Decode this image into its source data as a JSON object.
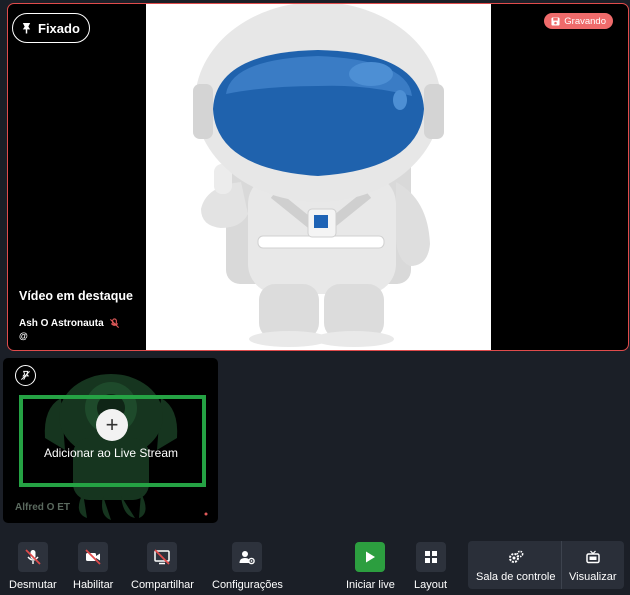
{
  "stage": {
    "pin_label": "Fixado",
    "recording_label": "Gravando",
    "featured_label": "Vídeo em destaque",
    "participant_name": "Ash O Astronauta",
    "participant_handle": "@"
  },
  "tile": {
    "add_label": "Adicionar ao Live Stream",
    "participant_name": "Alfred O ET"
  },
  "toolbar": {
    "unmute": "Desmutar",
    "enable": "Habilitar",
    "share": "Compartilhar",
    "settings": "Configurações",
    "start_live": "Iniciar live",
    "layout": "Layout",
    "control_room": "Sala de controle",
    "view": "Visualizar"
  },
  "colors": {
    "recording": "#ef6b6b",
    "live_green": "#2c9e3f",
    "stage_border": "#e04b4b"
  }
}
